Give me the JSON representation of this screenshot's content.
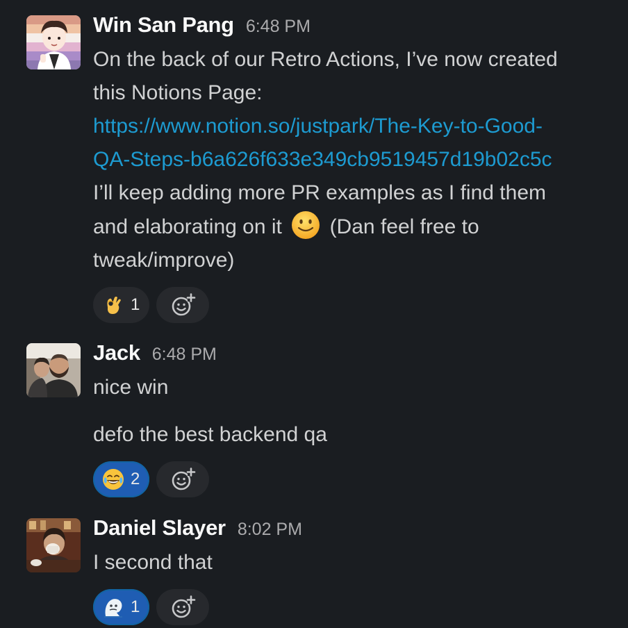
{
  "messages": [
    {
      "author": "Win San Pang",
      "time": "6:48 PM",
      "avatar": "cartoon-avatar",
      "lines": [
        "On the back of our Retro Actions, I’ve now created",
        "this Notions Page:"
      ],
      "link_lines": [
        "https://www.notion.so/justpark/The-Key-to-Good-",
        "QA-Steps-b6a626f633e349cb9519457d19b02c5c"
      ],
      "after_link": "I’ll keep adding more PR examples as I find them",
      "line_with_emoji_before": "and elaborating on it",
      "inline_emoji": "slightly-smiling-face",
      "line_with_emoji_after": "(Dan feel free to",
      "last_line": "tweak/improve)",
      "reaction": {
        "emoji": "ok-hand",
        "count": "1",
        "active": false
      }
    },
    {
      "author": "Jack",
      "time": "6:48 PM",
      "avatar": "photo-avatar",
      "line1": "nice win",
      "line2": "defo the best backend qa",
      "reaction": {
        "emoji": "joy",
        "count": "2",
        "active": true
      }
    },
    {
      "author": "Daniel Slayer",
      "time": "8:02 PM",
      "avatar": "photo-avatar",
      "line1": "I second that",
      "reaction": {
        "emoji": "custom-blob",
        "count": "1",
        "active": true
      }
    }
  ],
  "colors": {
    "background": "#1a1d21",
    "text": "#d1d2d3",
    "link": "#1d9bd1",
    "reaction_active": "#1f5db3"
  },
  "icons": {
    "add_reaction": "add-reaction-icon"
  }
}
